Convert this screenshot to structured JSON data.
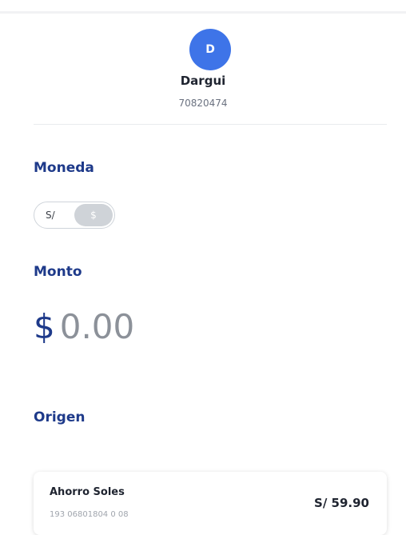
{
  "recipient": {
    "initial": "D",
    "name": "Dargui",
    "document": "70820474"
  },
  "currency": {
    "title": "Moneda",
    "options": [
      "S/",
      "$"
    ],
    "selected": "$"
  },
  "amount": {
    "title": "Monto",
    "symbol": "$",
    "value": "0.00"
  },
  "origin": {
    "title": "Origen",
    "account": {
      "name": "Ahorro Soles",
      "number": "193 06801804 0 08",
      "balance": "S/ 59.90"
    }
  },
  "colors": {
    "accent": "#3e74e8",
    "heading": "#1e3a8a"
  }
}
